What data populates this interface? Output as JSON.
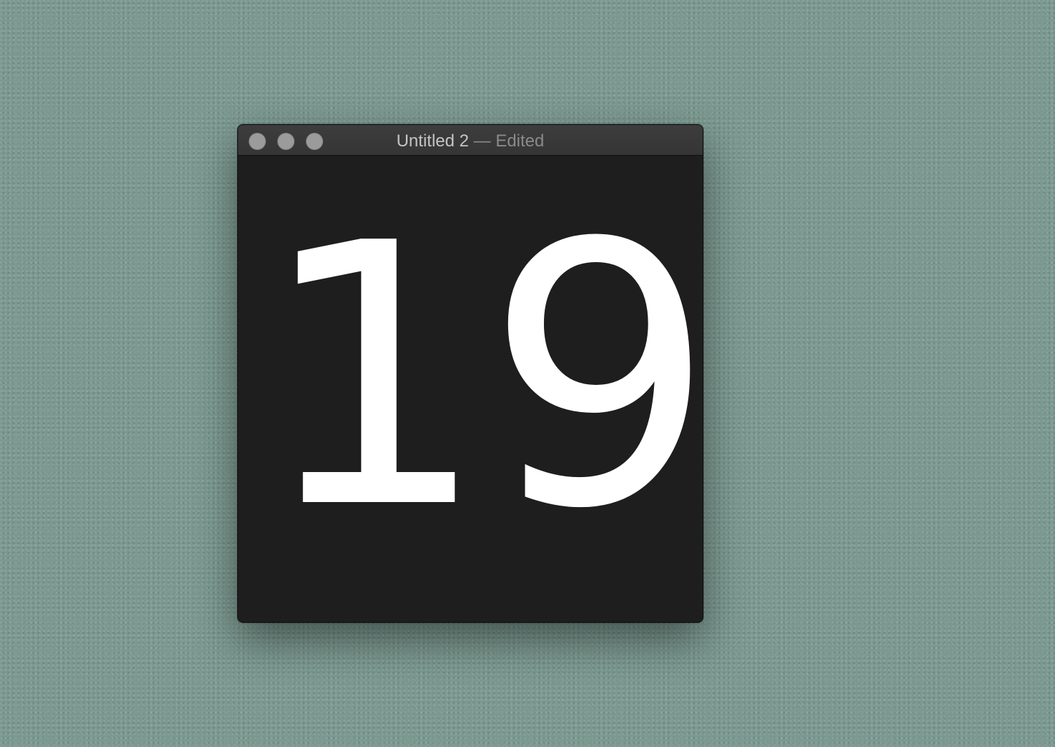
{
  "window": {
    "title": {
      "document_name": "Untitled 2",
      "separator": "—",
      "status": "Edited"
    },
    "traffic_lights": [
      {
        "icon": "close-icon"
      },
      {
        "icon": "minimize-icon"
      },
      {
        "icon": "zoom-icon"
      }
    ]
  },
  "content": {
    "text": "19"
  },
  "colors": {
    "desktop_background": "#7b9990",
    "window_background": "#1e1e1e",
    "titlebar": "#3a3a3a",
    "text": "#ffffff",
    "traffic_light_inactive": "#9b9b9b"
  }
}
